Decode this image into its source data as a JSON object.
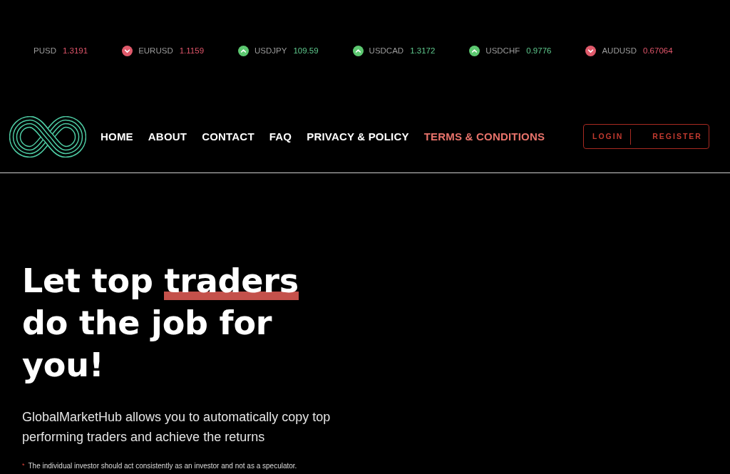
{
  "ticker": [
    {
      "symbol": "PUSD",
      "value": "1.3191",
      "rising": false,
      "show_icon": false
    },
    {
      "symbol": "EURUSD",
      "value": "1.1159",
      "rising": false,
      "show_icon": true
    },
    {
      "symbol": "USDJPY",
      "value": "109.59",
      "rising": true,
      "show_icon": true
    },
    {
      "symbol": "USDCAD",
      "value": "1.3172",
      "rising": true,
      "show_icon": true
    },
    {
      "symbol": "USDCHF",
      "value": "0.9776",
      "rising": true,
      "show_icon": true
    },
    {
      "symbol": "AUDUSD",
      "value": "0.67064",
      "rising": false,
      "show_icon": true
    }
  ],
  "header": {
    "nav": [
      {
        "label": "HOME",
        "selected": false
      },
      {
        "label": "ABOUT",
        "selected": false
      },
      {
        "label": "CONTACT",
        "selected": false
      },
      {
        "label": "FAQ",
        "selected": false
      },
      {
        "label": "PRIVACY & POLICY",
        "selected": false
      },
      {
        "label": "TERMS & CONDITIONS",
        "selected": true
      }
    ],
    "auth": {
      "login": "LOGIN",
      "register": "REGISTER"
    }
  },
  "hero": {
    "headline": [
      {
        "text": "Let top ",
        "highlight": false
      },
      {
        "text": "traders",
        "highlight": true
      },
      {
        "text": " do the job for you!",
        "highlight": false
      }
    ],
    "description": "GlobalMarketHub allows you to automatically copy top performing traders and achieve the returns",
    "footnote": {
      "mark": "*",
      "text": "The individual investor should act consistently as an investor and not as a speculator."
    }
  }
}
